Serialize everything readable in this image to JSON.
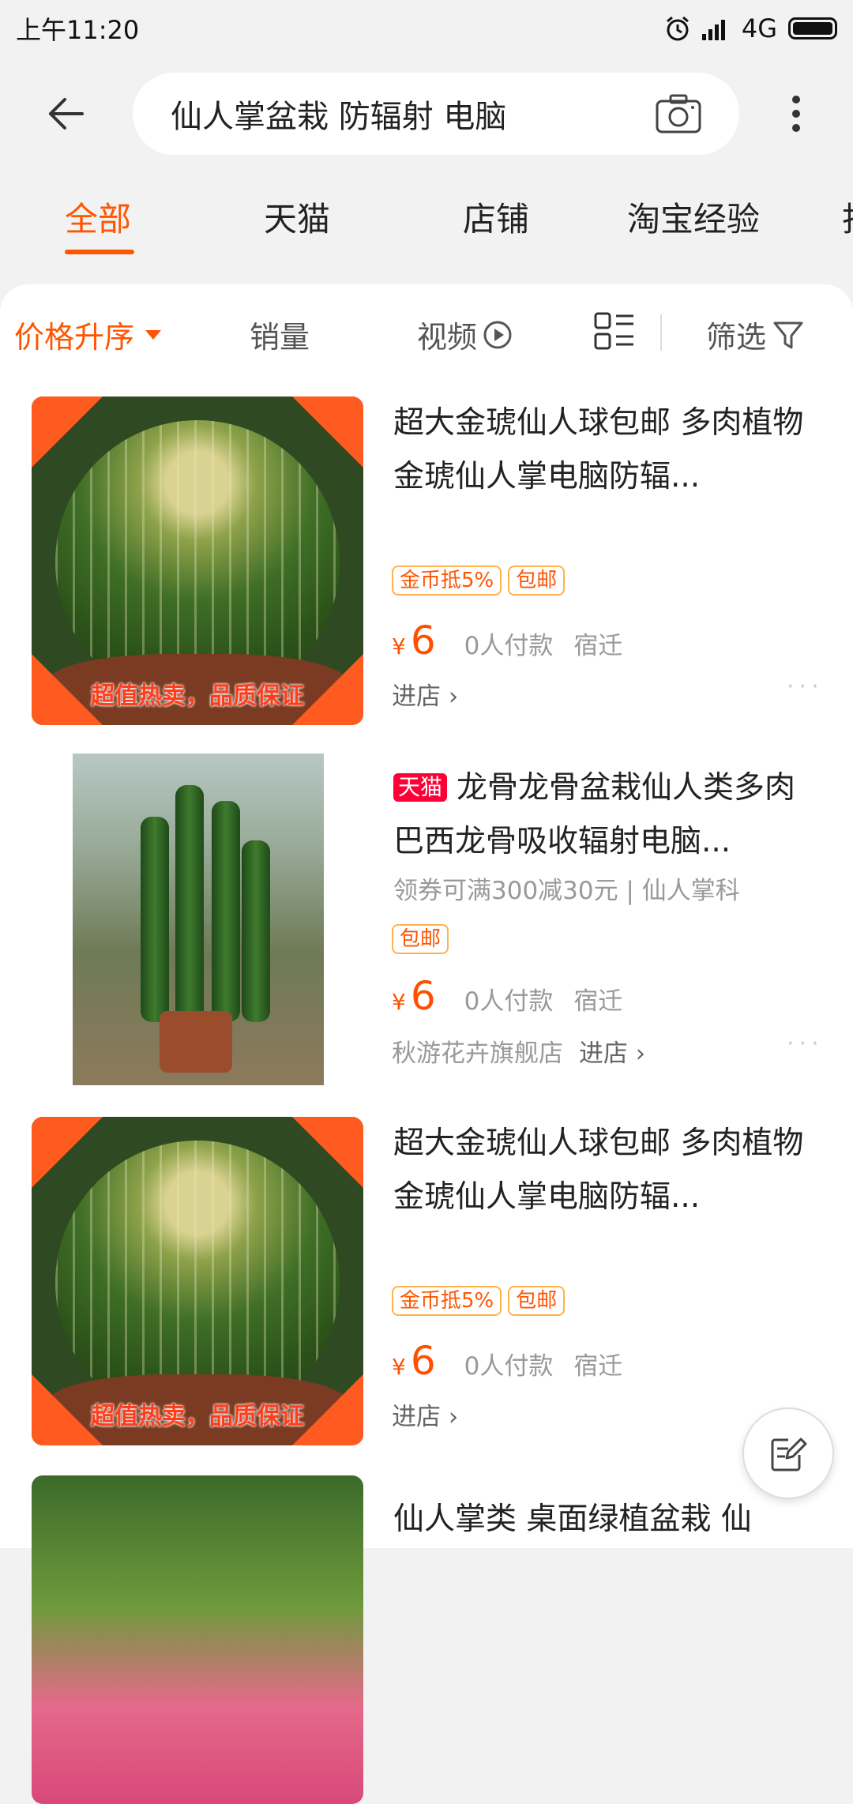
{
  "status_bar": {
    "time": "上午11:20",
    "network": "4G"
  },
  "search": {
    "query": "仙人掌盆栽 防辐射 电脑"
  },
  "tabs": [
    {
      "label": "全部"
    },
    {
      "label": "天猫"
    },
    {
      "label": "店铺"
    },
    {
      "label": "淘宝经验"
    },
    {
      "label": "找"
    }
  ],
  "sort_bar": {
    "price_asc": "价格升序",
    "sales": "销量",
    "video": "视频",
    "filter": "筛选"
  },
  "colors": {
    "accent": "#ff5500",
    "price": "#ff5000",
    "tmall": "#ff0036"
  },
  "products": [
    {
      "title": "超大金琥仙人球包邮 多肉植物 金琥仙人掌电脑防辐...",
      "tags": [
        "金币抵5%",
        "包邮"
      ],
      "currency": "¥",
      "price": "6",
      "sales": "0人付款",
      "location": "宿迁",
      "enter_store": "进店",
      "image_caption": "超值热卖，品质保证"
    },
    {
      "badge": "天猫",
      "title": "龙骨龙骨盆栽仙人类多肉巴西龙骨吸收辐射电脑...",
      "subtitle": "领券可满300减30元 | 仙人掌科",
      "tags": [
        "包邮"
      ],
      "currency": "¥",
      "price": "6",
      "sales": "0人付款",
      "location": "宿迁",
      "shop": "秋游花卉旗舰店",
      "enter_store": "进店"
    },
    {
      "title": "超大金琥仙人球包邮 多肉植物 金琥仙人掌电脑防辐...",
      "tags": [
        "金币抵5%",
        "包邮"
      ],
      "currency": "¥",
      "price": "6",
      "sales": "0人付款",
      "location": "宿迁",
      "enter_store": "进店",
      "image_caption": "超值热卖，品质保证"
    },
    {
      "title": "仙人掌类 桌面绿植盆栽 仙"
    }
  ]
}
